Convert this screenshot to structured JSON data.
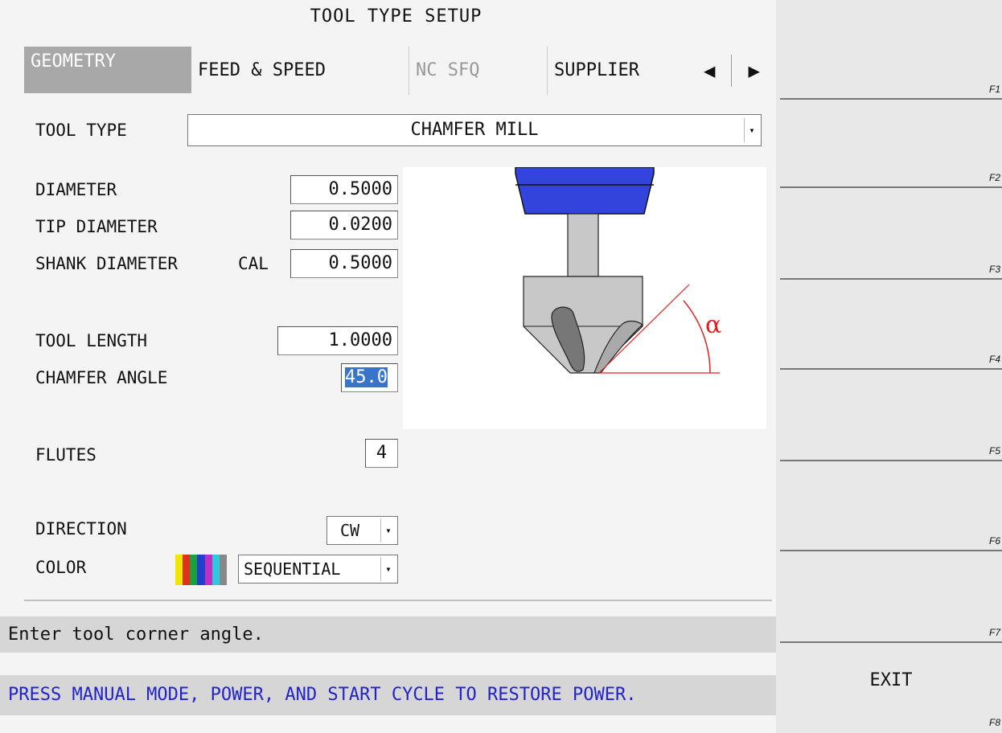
{
  "window": {
    "title": "TOOL TYPE SETUP"
  },
  "tabs": [
    {
      "label": "GEOMETRY",
      "state": "active"
    },
    {
      "label": "FEED & SPEED",
      "state": "normal"
    },
    {
      "label": "NC SFQ",
      "state": "disabled"
    },
    {
      "label": "SUPPLIER",
      "state": "normal"
    }
  ],
  "tab_arrows": {
    "left_icon": "left-triangle-icon",
    "right_icon": "right-triangle-icon"
  },
  "form": {
    "tool_type_label": "TOOL TYPE",
    "tool_type_value": "CHAMFER MILL",
    "diameter_label": "DIAMETER",
    "diameter_value": "0.5000",
    "tip_diameter_label": "TIP DIAMETER",
    "tip_diameter_value": "0.0200",
    "shank_diameter_label": "SHANK DIAMETER",
    "shank_cal_label": "CAL",
    "shank_diameter_value": "0.5000",
    "tool_length_label": "TOOL LENGTH",
    "tool_length_value": "1.0000",
    "chamfer_angle_label": "CHAMFER ANGLE",
    "chamfer_angle_value": "45.0",
    "flutes_label": "FLUTES",
    "flutes_value": "4",
    "direction_label": "DIRECTION",
    "direction_value": "CW",
    "color_label": "COLOR",
    "color_value": "SEQUENTIAL"
  },
  "diagram": {
    "angle_symbol": "α",
    "holder_color": "#3344dd",
    "body_color": "#c8c8c8",
    "angle_color": "#dd2222"
  },
  "status": {
    "prompt": "Enter tool corner angle.",
    "alert": "PRESS MANUAL MODE, POWER, AND START CYCLE TO RESTORE POWER.",
    "alert_color": "#2222cc"
  },
  "fkeys": [
    {
      "key": "F1",
      "label": ""
    },
    {
      "key": "F2",
      "label": ""
    },
    {
      "key": "F3",
      "label": ""
    },
    {
      "key": "F4",
      "label": ""
    },
    {
      "key": "F5",
      "label": ""
    },
    {
      "key": "F6",
      "label": ""
    },
    {
      "key": "F7",
      "label": ""
    },
    {
      "key": "F8",
      "label": "EXIT"
    }
  ],
  "color_swatch": [
    "#f2e600",
    "#e0301e",
    "#1ea03c",
    "#2040d0",
    "#c030c0",
    "#30c8e0",
    "#888888"
  ]
}
